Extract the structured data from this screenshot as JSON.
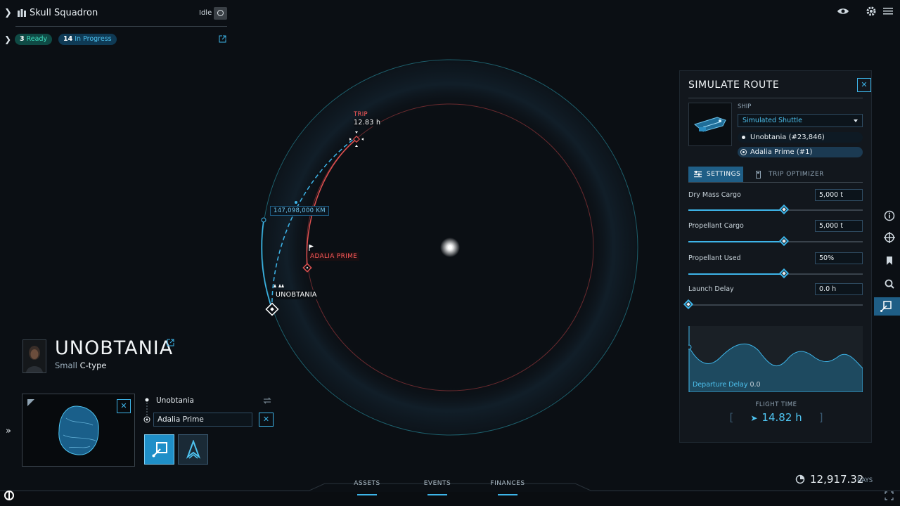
{
  "crew": {
    "name": "Skull Squadron",
    "status": "Idle"
  },
  "tasks": {
    "ready_count": "3",
    "ready_label": "Ready",
    "progress_count": "14",
    "progress_label": "In Progress"
  },
  "map": {
    "trip_label": "TRIP",
    "trip_time": "12.83 h",
    "distance": "147,098,000 KM",
    "destination_label": "ADALIA PRIME",
    "origin_label": "UNOBTANIA"
  },
  "route_panel": {
    "title": "SIMULATE ROUTE",
    "ship_label": "SHIP",
    "ship_selected": "Simulated Shuttle",
    "origin": "Unobtania (#23,846)",
    "destination": "Adalia Prime (#1)",
    "tabs": [
      {
        "label": "SETTINGS",
        "active": true
      },
      {
        "label": "TRIP OPTIMIZER",
        "active": false
      }
    ],
    "params": [
      {
        "label": "Dry Mass Cargo",
        "value": "5,000 t",
        "level": 0.55
      },
      {
        "label": "Propellant Cargo",
        "value": "5,000 t",
        "level": 0.55
      },
      {
        "label": "Propellant Used",
        "value": "50%",
        "level": 0.55
      },
      {
        "label": "Launch Delay",
        "value": "0.0 h",
        "level": 0.0
      }
    ],
    "departure_delay_label": "Departure Delay",
    "departure_delay_value": "0.0",
    "flight_time_label": "FLIGHT TIME",
    "flight_time_value": "14.82 h"
  },
  "asteroid": {
    "name": "UNOBTANIA",
    "size": "Small",
    "type": "C-type"
  },
  "route_stops": {
    "origin": "Unobtania",
    "destination": "Adalia Prime"
  },
  "bottom_nav": [
    "ASSETS",
    "EVENTS",
    "FINANCES"
  ],
  "days": {
    "value": "12,917.32",
    "unit": "DAYS"
  },
  "colors": {
    "accent": "#3db4e8",
    "danger": "#e05050",
    "ready": "#3fe0c0",
    "background": "#0b0f14"
  },
  "icons": [
    "crew-icon",
    "eye-icon",
    "gear-icon",
    "menu-icon",
    "info-icon",
    "compass-icon",
    "bookmark-icon",
    "search-icon",
    "route-icon",
    "ship-icon",
    "swap-icon",
    "external-link-icon",
    "expand-icon",
    "fullscreen-icon",
    "logo-icon"
  ]
}
